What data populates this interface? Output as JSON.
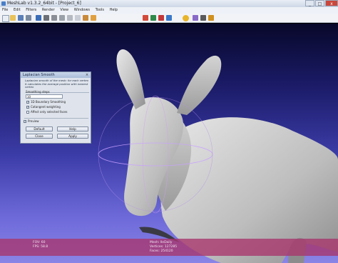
{
  "window": {
    "title": "MeshLab v1.3.2_64bit - [Project_6]",
    "minimize": "_",
    "maximize": "□",
    "close": "x"
  },
  "menu": [
    "File",
    "Edit",
    "Filters",
    "Render",
    "View",
    "Windows",
    "Tools",
    "Help"
  ],
  "toolbar": {
    "icons": [
      "new-icon",
      "open-icon",
      "save-icon",
      "snapshot-icon",
      "layers-icon",
      "points-icon",
      "wireframe-icon",
      "hidden-lines-icon",
      "flat-icon",
      "smooth-icon",
      "texture-icon",
      "color-icon",
      "light-icon",
      "annotation-icon",
      "measure-icon",
      "select-faces-icon",
      "select-vertices-icon",
      "paint-icon",
      "align-icon",
      "pick-icon"
    ],
    "colors": {
      "accent": "#4a7fc8",
      "warning": "#e8b429"
    }
  },
  "dialog": {
    "title": "Laplacian Smooth",
    "description": "Laplacian smooth of the mesh: for each vertex it calculates the average position with nearest vertex",
    "smoothing_steps_label": "Smoothing steps",
    "smoothing_steps_value": "10",
    "boundary_label": "1D Boundary Smoothing",
    "cotangent_label": "Cotangent weighting",
    "selected_label": "Affect only selected faces",
    "preview_label": "Preview",
    "boundary_checked": true,
    "cotangent_checked": true,
    "selected_checked": false,
    "preview_checked": true,
    "default_button": "Default",
    "help_button": "Help",
    "close_button": "Close",
    "apply_button": "Apply"
  },
  "status": {
    "fov": "FOV: 60",
    "fps": "FPS:   58.8",
    "mesh": "Mesh: lleDaily",
    "vertices": "Vertices: 127285",
    "faces": "Faces: 254120"
  }
}
